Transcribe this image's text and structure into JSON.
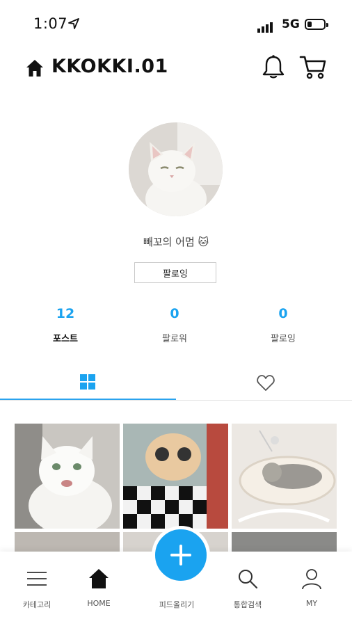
{
  "status_bar": {
    "time": "1:07",
    "network": "5G",
    "battery_level": 0.2,
    "icons": [
      "location-arrow-icon",
      "signal-icon",
      "battery-icon"
    ]
  },
  "header": {
    "title": "KKOKKI.01",
    "icons": [
      "home-icon",
      "bell-icon",
      "cart-icon"
    ]
  },
  "profile": {
    "nickname": "빼꼬의 어멈 🐱",
    "follow_button": "팔로잉"
  },
  "stats": {
    "posts": {
      "count": "12",
      "label": "포스트"
    },
    "followers": {
      "count": "0",
      "label": "팔로워"
    },
    "following": {
      "count": "0",
      "label": "팔로잉"
    }
  },
  "tabs": {
    "active": "grid",
    "icons": [
      "grid-icon",
      "heart-outline-icon"
    ]
  },
  "bottom_nav": {
    "items": [
      {
        "label": "카테고리",
        "icon": "menu-icon"
      },
      {
        "label": "HOME",
        "icon": "home-icon"
      },
      {
        "label": "피드올리기",
        "icon": "plus-icon"
      },
      {
        "label": "통합검색",
        "icon": "search-icon"
      },
      {
        "label": "MY",
        "icon": "user-icon"
      }
    ]
  },
  "colors": {
    "accent": "#1aa3f0",
    "text": "#111111",
    "muted": "#555555"
  }
}
